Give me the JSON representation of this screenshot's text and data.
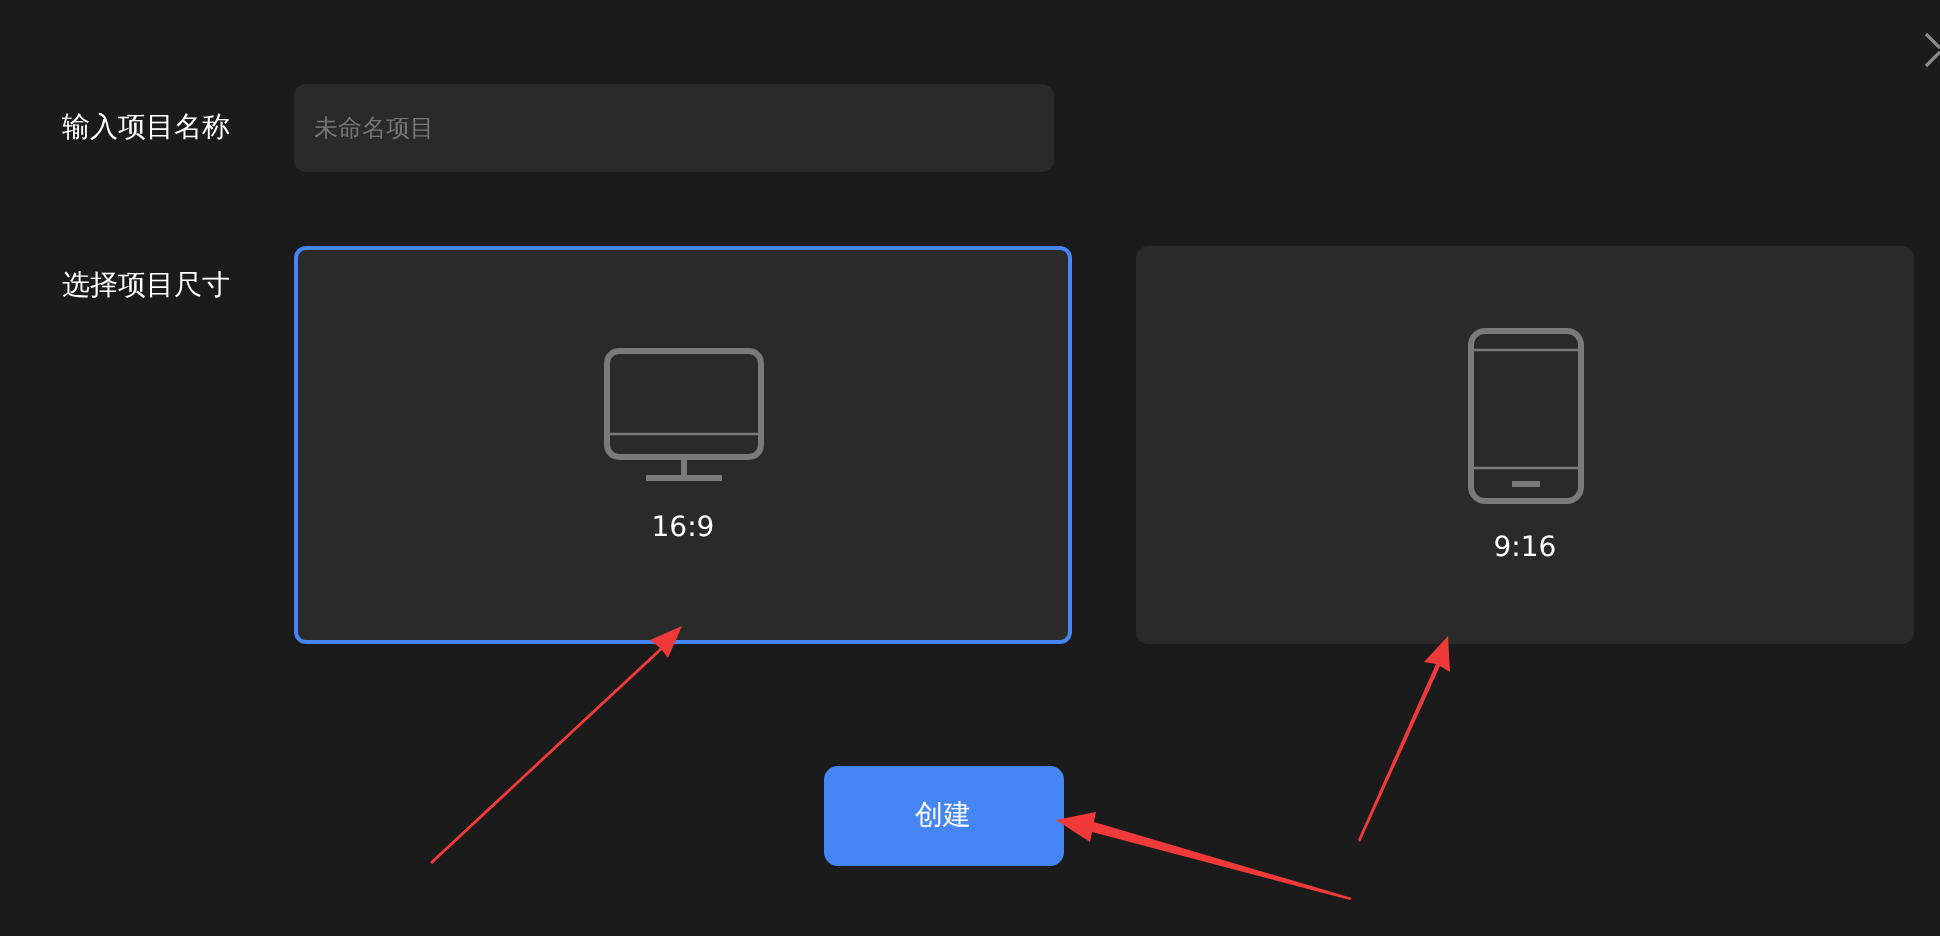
{
  "name_field": {
    "label": "输入项目名称",
    "placeholder": "未命名项目"
  },
  "size_picker": {
    "label": "选择项目尺寸",
    "options": [
      {
        "kind": "landscape",
        "label": "16:9",
        "selected": true
      },
      {
        "kind": "portrait",
        "label": "9:16",
        "selected": false
      }
    ]
  },
  "create_button": "创建"
}
